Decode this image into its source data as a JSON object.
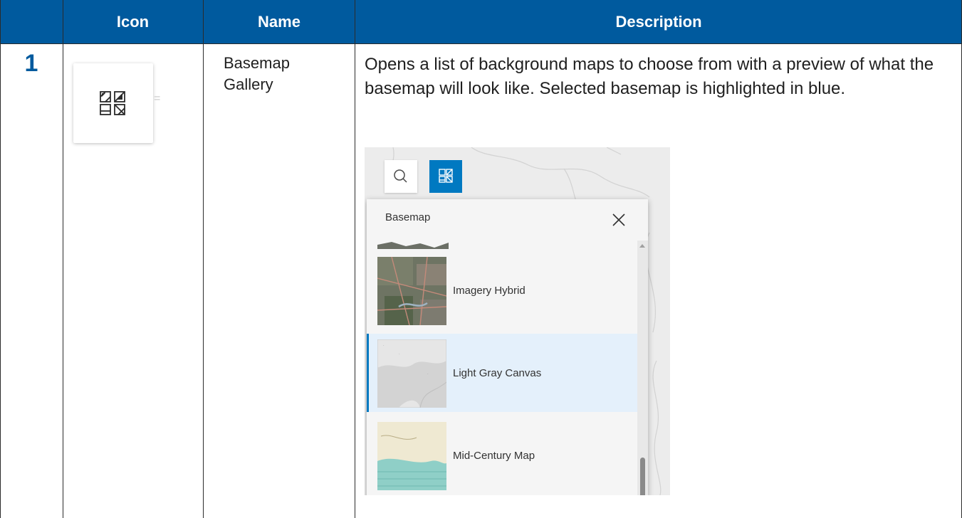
{
  "table": {
    "headers": [
      "",
      "Icon",
      "Name",
      "Description"
    ],
    "rows": [
      {
        "number": "1",
        "icon": "basemap-gallery-icon",
        "name": "Basemap Gallery",
        "description": "Opens a list of background maps to choose from with a preview of what the basemap will look like. Selected basemap is highlighted in blue."
      }
    ]
  },
  "screenshot": {
    "panel_title": "Basemap",
    "items": [
      {
        "label": "Imagery Hybrid",
        "selected": false
      },
      {
        "label": "Light Gray Canvas",
        "selected": true
      },
      {
        "label": "Mid-Century Map",
        "selected": false
      }
    ],
    "colors": {
      "accent": "#0079c1",
      "header": "#005a9e",
      "selected_bg": "#e4f0fb"
    }
  }
}
